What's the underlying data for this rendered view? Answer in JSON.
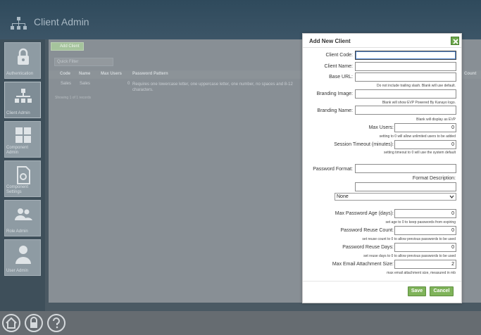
{
  "app": {
    "title": "Client Admin",
    "nav": [
      {
        "label": "Authentication",
        "icon": "lock-icon"
      },
      {
        "label": "Client Admin",
        "icon": "org-chart-icon"
      },
      {
        "label": "Component Admin",
        "icon": "grid-icon"
      },
      {
        "label": "Component Settings",
        "icon": "settings-doc-icon"
      },
      {
        "label": "Role Admin",
        "icon": "users-icon"
      },
      {
        "label": "User Admin",
        "icon": "user-icon"
      }
    ],
    "toolbar": {
      "add_label": "Add Client",
      "filter_placeholder": "Quick Filter"
    },
    "grid": {
      "columns": [
        "Code",
        "Name",
        "Max Users",
        "Password Pattern",
        "Count"
      ],
      "rows": [
        {
          "code": "Sales",
          "name": "Sales",
          "max_users": "0",
          "pattern": "Requires one lowercase letter, one uppercase letter, one number, no spaces and 8-12 characters."
        }
      ],
      "records": "Showing 1 of 1 records"
    }
  },
  "modal": {
    "title": "Add New Client",
    "fields": {
      "client_code": {
        "label": "Client Code:",
        "value": ""
      },
      "client_name": {
        "label": "Client Name:",
        "value": ""
      },
      "base_url": {
        "label": "Base URL:",
        "value": "",
        "hint": "Do not include trailing slash. Blank will use default."
      },
      "branding_image": {
        "label": "Branding Image:",
        "value": "",
        "hint": "Blank will show EVP Powered By Kanayo logo."
      },
      "branding_name": {
        "label": "Branding Name:",
        "value": "",
        "hint": "Blank will display as EVP"
      },
      "max_users": {
        "label": "Max Users:",
        "value": "0",
        "hint": "setting to 0 will allow unlimited users to be added"
      },
      "session_timeout": {
        "label": "Session Timeout (minutes):",
        "value": "0",
        "hint": "setting timeout to 0 will use the system default"
      },
      "password_format": {
        "label": "Password Format:",
        "value": ""
      },
      "format_description": {
        "label": "Format Description:",
        "value": ""
      },
      "preset": {
        "value": "None"
      },
      "max_password_age": {
        "label": "Max Password Age (days):",
        "value": "0",
        "hint": "set age to 0 to keep passwords from expiring"
      },
      "password_reuse_count": {
        "label": "Password Reuse Count:",
        "value": "0",
        "hint": "set reuse count to 0 to allow previous passwords to be used"
      },
      "password_reuse_days": {
        "label": "Password Reuse Days:",
        "value": "0",
        "hint": "set reuse days to 0 to allow previous passwords to be used"
      },
      "max_email_attachment": {
        "label": "Max Email Attachment Size:",
        "value": "2",
        "hint": "max email attachment size, measured in mb"
      }
    },
    "buttons": {
      "save": "Save",
      "cancel": "Cancel"
    }
  },
  "colors": {
    "accent_green": "#7fb35a",
    "topbar": "#2f4a5c"
  }
}
